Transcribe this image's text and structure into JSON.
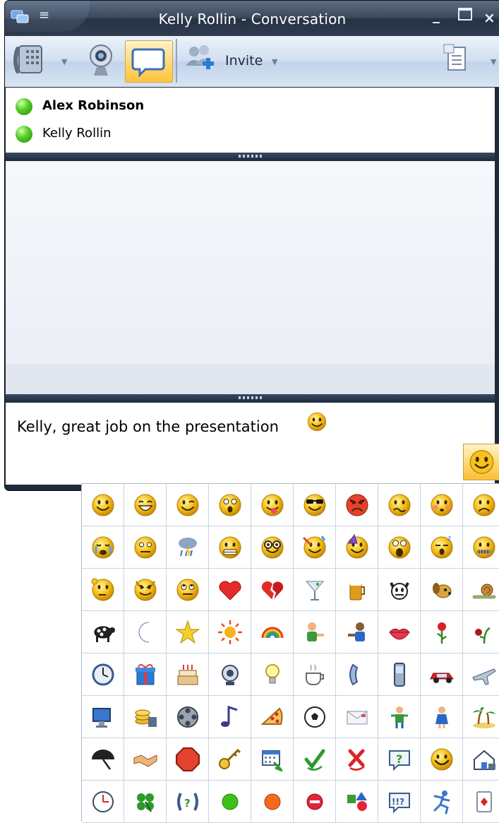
{
  "window": {
    "title": "Kelly Rollin - Conversation",
    "controls": [
      "minimize-icon",
      "maximize-icon",
      "close-icon"
    ]
  },
  "toolbar": {
    "invite_label": "Invite",
    "buttons": [
      "phone-icon",
      "webcam-icon",
      "im-bubble-icon",
      "invite-people-icon",
      "shared-document-icon"
    ]
  },
  "participants": [
    {
      "name": "Alex Robinson",
      "status_color": "#3fbf1a",
      "bold": true
    },
    {
      "name": "Kelly Rollin",
      "status_color": "#3fbf1a",
      "bold": false
    }
  ],
  "compose": {
    "text": "Kelly, great job on the presentation"
  },
  "emoticons": [
    [
      "smile",
      "laugh",
      "wink",
      "surprised",
      "tongue",
      "sunglasses",
      "angry",
      "confused",
      "embarrassed",
      "sad"
    ],
    [
      "crying",
      "disappointed",
      "rain-cloud",
      "grimace",
      "nerd",
      "party",
      "party-hat",
      "shocked",
      "sleepy",
      "zipped-mouth"
    ],
    [
      "thinking",
      "devil",
      "eye-roll",
      "heart",
      "broken-heart",
      "martini",
      "beer",
      "cat",
      "dog",
      "snail"
    ],
    [
      "sheep",
      "moon",
      "star",
      "sun",
      "rainbow",
      "hug-left",
      "hug-right",
      "lips",
      "red-rose",
      "wilted-rose"
    ],
    [
      "clock",
      "gift",
      "birthday-cake",
      "camera",
      "light-bulb",
      "coffee",
      "phone",
      "mobile-phone",
      "car",
      "airplane"
    ],
    [
      "computer",
      "money",
      "film",
      "music-note",
      "pizza",
      "soccer-ball",
      "envelope",
      "boy",
      "girl",
      "island"
    ],
    [
      "umbrella",
      "handshake",
      "stop",
      "key",
      "calendar",
      "check",
      "cross",
      "question",
      "smile-variant",
      "home"
    ],
    [
      "clock-alt",
      "clover",
      "phone-question",
      "green-dot",
      "orange-dot",
      "no-entry",
      "shapes",
      "exclamation-question",
      "running",
      "cards"
    ]
  ],
  "colors": {
    "frame": "#1e2a3b",
    "toolbar": "#d2dff0",
    "highlight": "#ffd56b",
    "smiley": "#f7c21b"
  }
}
